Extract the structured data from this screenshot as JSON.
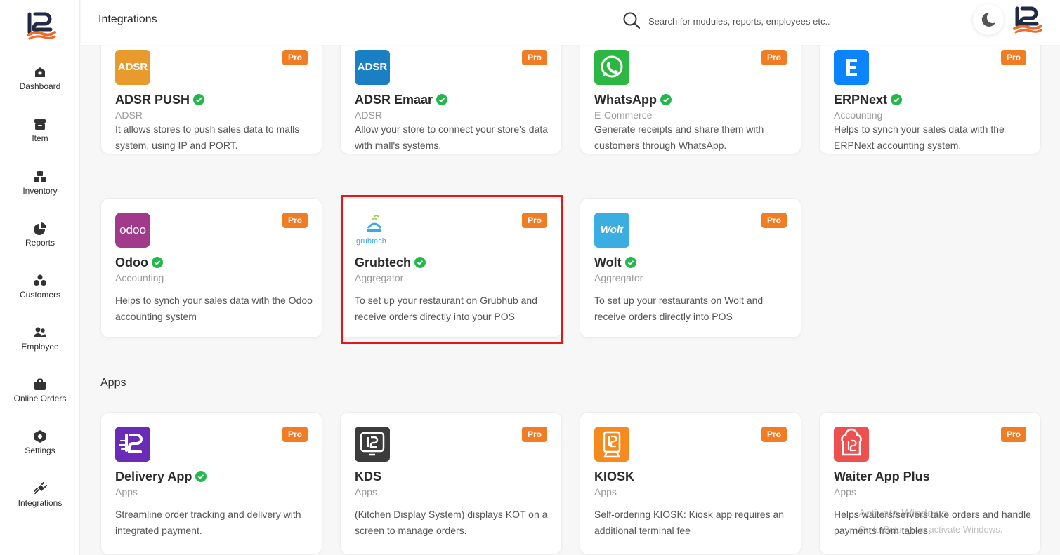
{
  "header": {
    "title": "Integrations",
    "search_placeholder": "Search for modules, reports, employees etc.."
  },
  "sidebar": {
    "items": [
      {
        "label": "Dashboard",
        "icon": "dashboard-icon"
      },
      {
        "label": "Item",
        "icon": "item-icon"
      },
      {
        "label": "Inventory",
        "icon": "inventory-icon"
      },
      {
        "label": "Reports",
        "icon": "reports-icon"
      },
      {
        "label": "Customers",
        "icon": "customers-icon"
      },
      {
        "label": "Employee",
        "icon": "employee-icon"
      },
      {
        "label": "Online Orders",
        "icon": "online-orders-icon"
      },
      {
        "label": "Settings",
        "icon": "settings-icon"
      },
      {
        "label": "Integrations",
        "icon": "integrations-icon"
      }
    ]
  },
  "badge_label": "Pro",
  "integrations": [
    {
      "name": "ADSR PUSH",
      "category": "ADSR",
      "description": "It allows stores to push sales data to malls system, using IP and PORT.",
      "logo_text": "ADSR",
      "logo_color": "#e89a2c"
    },
    {
      "name": "ADSR Emaar",
      "category": "ADSR",
      "description": "Allow your store to connect your store's data with mall's systems.",
      "logo_text": "ADSR",
      "logo_color": "#1b7fc4"
    },
    {
      "name": "WhatsApp",
      "category": "E-Commerce",
      "description": "Generate receipts and share them with customers through WhatsApp.",
      "logo_color": "#2bb741"
    },
    {
      "name": "ERPNext",
      "category": "Accounting",
      "description": "Helps to synch your sales data with the ERPNext accounting system.",
      "logo_color": "#0a84ff"
    },
    {
      "name": "Odoo",
      "category": "Accounting",
      "description": "Helps to synch your sales data with the Odoo accounting system",
      "logo_text": "odoo",
      "logo_color": "#a13a8a"
    },
    {
      "name": "Grubtech",
      "category": "Aggregator",
      "description": "To set up your restaurant on Grubhub and receive orders directly into your POS",
      "logo_text": "grubtech"
    },
    {
      "name": "Wolt",
      "category": "Aggregator",
      "description": "To set up your restaurants on Wolt and receive orders directly into POS",
      "logo_text": "Wolt",
      "logo_color": "#3aaee0"
    }
  ],
  "apps_title": "Apps",
  "apps": [
    {
      "name": "Delivery App",
      "category": "Apps",
      "description": "Streamline order tracking and delivery with integrated payment.",
      "logo_color": "#6a2bb7"
    },
    {
      "name": "KDS",
      "category": "Apps",
      "description": "(Kitchen Display System) displays KOT on a screen to manage orders.",
      "logo_color": "#3c3c3c"
    },
    {
      "name": "KIOSK",
      "category": "Apps",
      "description": "Self-ordering KIOSK: Kiosk app requires an additional terminal fee",
      "logo_color": "#f58a1f"
    },
    {
      "name": "Waiter App Plus",
      "category": "Apps",
      "description": "Helps waiters/servers take orders and handle payments from tables.",
      "logo_color": "#ee4f4f"
    }
  ],
  "watermark": {
    "line1": "Activate Windows",
    "line2": "Go to Settings to activate Windows."
  },
  "colors": {
    "pro_badge": "#f07c24",
    "verified": "#22b94a",
    "highlight": "#e01818"
  }
}
